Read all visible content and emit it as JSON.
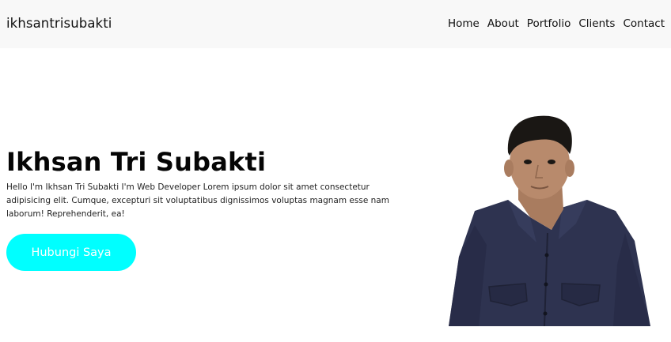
{
  "navbar": {
    "brand": "ikhsantrisubakti",
    "links": [
      "Home",
      "About",
      "Portfolio",
      "Clients",
      "Contact"
    ]
  },
  "hero": {
    "name": "Ikhsan Tri Subakti",
    "description": "Hello I'm Ikhsan Tri Subakti I'm Web Developer Lorem ipsum dolor sit amet consectetur adipisicing elit. Cumque, excepturi sit voluptatibus dignissimos voluptas magnam esse nam laborum! Reprehenderit, ea!",
    "cta_label": "Hubungi Saya"
  },
  "colors": {
    "navbar_bg": "#f8f8f8",
    "cta_bg": "#00ffff",
    "cta_text": "#ffffff",
    "shirt": "#2e3350",
    "skin": "#b88a6c",
    "hair": "#1a1714"
  }
}
